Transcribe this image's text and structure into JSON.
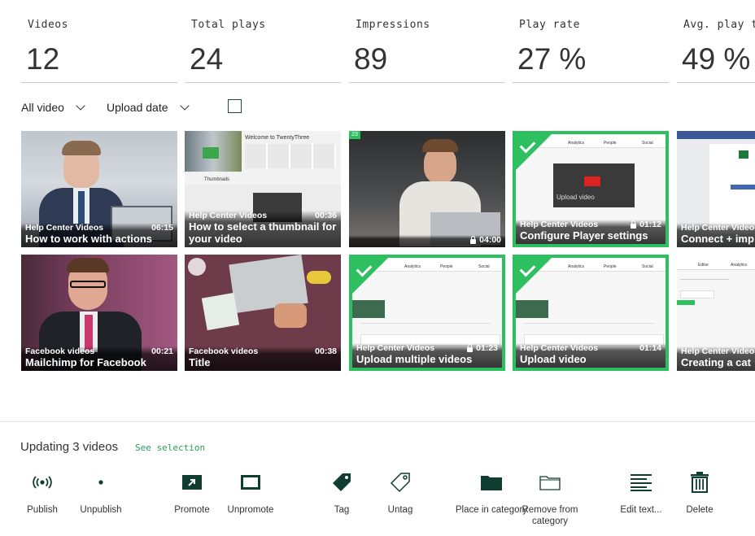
{
  "stats": [
    {
      "label": "Videos",
      "value": "12"
    },
    {
      "label": "Total plays",
      "value": "24"
    },
    {
      "label": "Impressions",
      "value": "89"
    },
    {
      "label": "Play rate",
      "value": "27 %"
    },
    {
      "label": "Avg. play t",
      "value": "49 %"
    }
  ],
  "filters": {
    "category": "All video",
    "sort": "Upload date"
  },
  "videos": [
    {
      "category": "Help Center Videos",
      "duration": "06:15",
      "title": "How to work with actions",
      "selected": false,
      "locked": false
    },
    {
      "category": "Help Center Videos",
      "duration": "00:36",
      "title": "How to select a thumbnail for your video",
      "selected": false,
      "locked": false
    },
    {
      "category": "",
      "duration": "04:00",
      "title": "",
      "selected": false,
      "locked": true
    },
    {
      "category": "Help Center Videos",
      "duration": "01:12",
      "title": "Configure Player settings",
      "selected": true,
      "locked": true
    },
    {
      "category": "Help Center Videos",
      "duration": "",
      "title": "Connect + imp",
      "selected": false,
      "locked": false
    },
    {
      "category": "Facebook videos",
      "duration": "00:21",
      "title": "Mailchimp for Facebook",
      "selected": false,
      "locked": false
    },
    {
      "category": "Facebook videos",
      "duration": "00:38",
      "title": "Title",
      "selected": false,
      "locked": false
    },
    {
      "category": "Help Center Videos",
      "duration": "01:23",
      "title": "Upload multiple videos",
      "selected": true,
      "locked": true
    },
    {
      "category": "Help Center Videos",
      "duration": "01:14",
      "title": "Upload video",
      "selected": true,
      "locked": false
    },
    {
      "category": "Help Center Videos",
      "duration": "",
      "title": "Creating a cat",
      "selected": false,
      "locked": false
    }
  ],
  "thumb_text": {
    "welcome": "Welcome to TwentyThree",
    "thumbnails": "Thumbnails",
    "upload_video": "Upload video",
    "analytics": "Analytics",
    "people": "People",
    "social": "Social",
    "editor": "Editor",
    "badge": "23"
  },
  "bulk": {
    "updating": "Updating 3 videos",
    "see_selection": "See selection",
    "actions": [
      {
        "icon": "broadcast-icon",
        "label": "Publish"
      },
      {
        "icon": "dot-icon",
        "label": "Unpublish"
      },
      {
        "icon": "promote-icon",
        "label": "Promote"
      },
      {
        "icon": "unpromote-icon",
        "label": "Unpromote"
      },
      {
        "icon": "tag-icon",
        "label": "Tag"
      },
      {
        "icon": "untag-icon",
        "label": "Untag"
      },
      {
        "icon": "folder-icon",
        "label": "Place in category"
      },
      {
        "icon": "folder-outline-icon",
        "label": "Remove from category"
      },
      {
        "icon": "text-lines-icon",
        "label": "Edit text..."
      },
      {
        "icon": "trash-icon",
        "label": "Delete"
      }
    ]
  },
  "colors": {
    "accent": "#2ec060",
    "dark_green": "#0f3d30",
    "link_green": "#2aa055"
  }
}
